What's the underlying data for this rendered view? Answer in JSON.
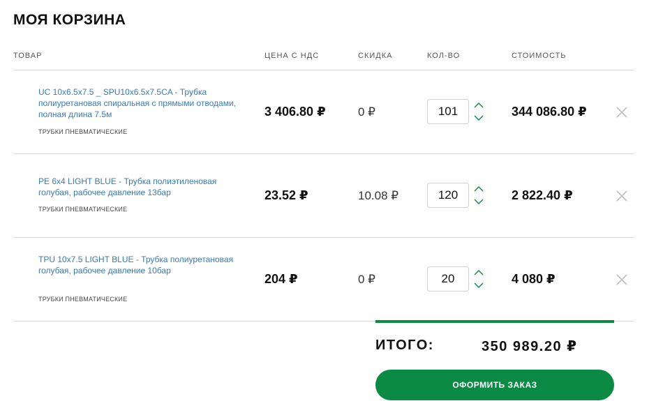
{
  "page": {
    "title": "МОЯ КОРЗИНА"
  },
  "table": {
    "headers": {
      "product": "ТОВАР",
      "price": "ЦЕНА С НДС",
      "discount": "СКИДКА",
      "qty": "КОЛ-ВО",
      "total": "СТОИМОСТЬ"
    },
    "rows": [
      {
        "name": "UC 10x6.5x7.5 _ SPU10x6.5x7.5CA - Трубка полиуретановая спиральная с прямыми отводами, полная длина 7.5м",
        "category": "ТРУБКИ ПНЕВМАТИЧЕСКИЕ",
        "price": "3 406.80 ₽",
        "discount": "0 ₽",
        "qty": "101",
        "total": "344 086.80 ₽"
      },
      {
        "name": "PE 6x4 LIGHT BLUE - Трубка полиэтиленовая голубая, рабочее давление 13бар",
        "category": "ТРУБКИ ПНЕВМАТИЧЕСКИЕ",
        "price": "23.52 ₽",
        "discount": "10.08 ₽",
        "qty": "120",
        "total": "2 822.40 ₽"
      },
      {
        "name": "TPU 10x7.5 LIGHT BLUE - Трубка полиуретановая голубая, рабочее давление 10бар",
        "category": "ТРУБКИ ПНЕВМАТИЧЕСКИЕ",
        "price": "204 ₽",
        "discount": "0 ₽",
        "qty": "20",
        "total": "4 080 ₽"
      }
    ]
  },
  "summary": {
    "label": "ИТОГО:",
    "value": "350 989.20 ₽",
    "checkout_label": "ОФОРМИТЬ ЗАКАЗ"
  },
  "icons": {
    "qty_increase": "chevron-up-icon",
    "qty_decrease": "chevron-down-icon",
    "remove": "close-icon"
  },
  "colors": {
    "accent": "#0a8a43",
    "link": "#3a7ab6",
    "divider": "#d8d8d8",
    "icon_muted": "#bdbdbd"
  }
}
